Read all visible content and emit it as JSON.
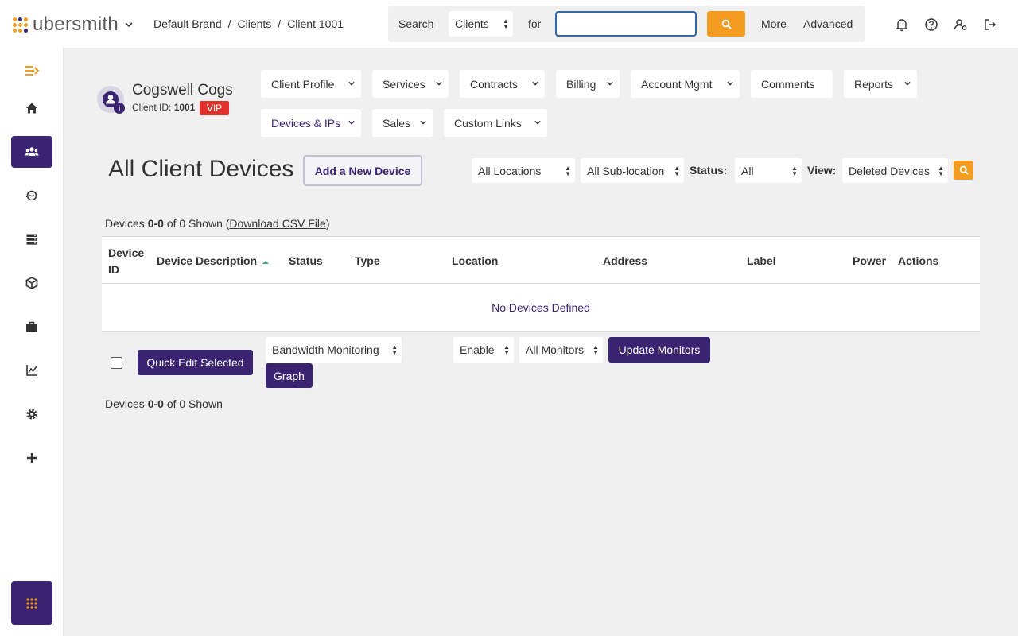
{
  "app": {
    "logo_text": "ubersmith"
  },
  "breadcrumb": [
    "Default Brand",
    "Clients",
    "Client 1001"
  ],
  "search": {
    "label": "Search",
    "scope": "Clients",
    "for_label": "for",
    "value": "",
    "more": "More",
    "advanced": "Advanced"
  },
  "client": {
    "name": "Cogswell Cogs",
    "id_label": "Client ID:",
    "id": "1001",
    "badge": "VIP"
  },
  "nav": {
    "client_profile": "Client Profile",
    "services": "Services",
    "contracts": "Contracts",
    "billing": "Billing",
    "account_mgmt": "Account Mgmt",
    "comments": "Comments",
    "reports": "Reports",
    "devices_ips": "Devices & IPs",
    "sales": "Sales",
    "custom_links": "Custom Links"
  },
  "page": {
    "title": "All Client Devices",
    "add_button": "Add a New Device"
  },
  "filters": {
    "location": "All Locations",
    "sublocation": "All Sub-location",
    "status_label": "Status:",
    "status": "All",
    "view_label": "View:",
    "view": "Deleted Devices"
  },
  "summary_top": {
    "prefix": "Devices",
    "range": "0-0",
    "suffix": "of 0 Shown (",
    "csv": "Download CSV File",
    "close": ")"
  },
  "table": {
    "headers": {
      "device_id_1": "Device",
      "device_id_2": "ID",
      "description": "Device Description",
      "status": "Status",
      "type": "Type",
      "location": "Location",
      "address": "Address",
      "label": "Label",
      "power": "Power",
      "actions": "Actions"
    },
    "empty": "No Devices Defined"
  },
  "bulk": {
    "quick_edit": "Quick Edit Selected",
    "monitor_type": "Bandwidth Monitoring",
    "graph": "Graph",
    "enable": "Enable",
    "monitors": "All Monitors",
    "update": "Update Monitors"
  },
  "summary_bottom": {
    "prefix": "Devices",
    "range": "0-0",
    "suffix": "of 0 Shown"
  },
  "colors": {
    "brand_purple": "#3a2472",
    "accent_orange": "#f39c1f",
    "vip_red": "#e0302c"
  }
}
